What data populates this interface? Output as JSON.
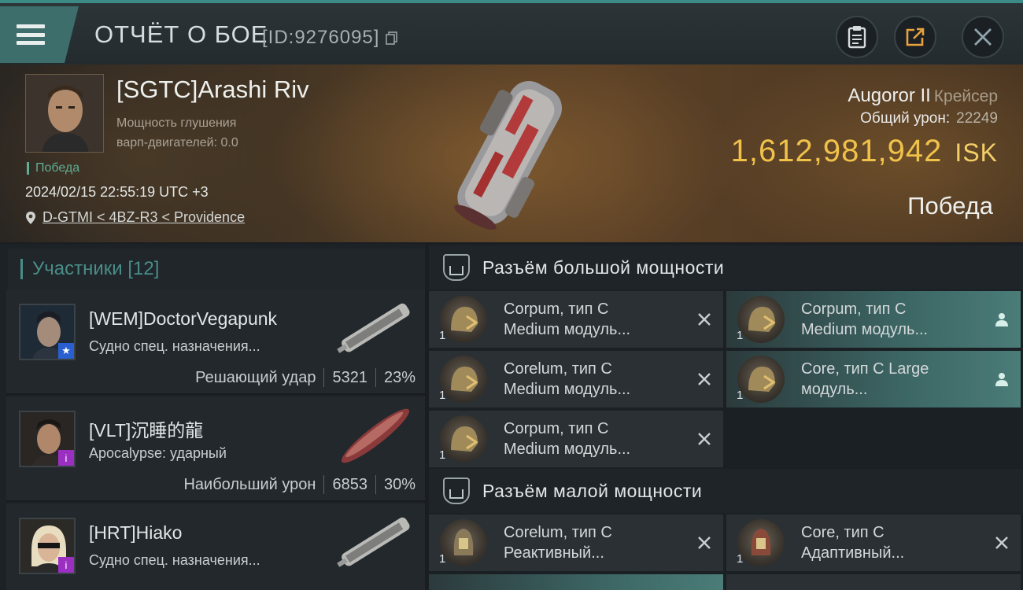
{
  "header": {
    "title": "ОТЧЁТ О БОЕ",
    "report_id": "[ID:9276095]",
    "buttons": {
      "clipboard_icon": "clipboard-icon",
      "share_icon": "share-icon",
      "close_icon": "close-icon"
    }
  },
  "victim": {
    "name": "[SGTC]Arashi Riv",
    "jam_label_line1": "Мощность глушения",
    "jam_label_line2": "варп-двигателей: 0.0",
    "status": "Победа",
    "datetime": "2024/02/15 22:55:19 UTC +3",
    "location": "D-GTMI < 4BZ-R3 < Providence",
    "ship": "Augoror II",
    "ship_class": "Крейсер",
    "total_damage_label": "Общий урон:",
    "total_damage": "22249",
    "isk_value": "1,612,981,942",
    "isk_unit": "ISK",
    "result": "Победа"
  },
  "participants": {
    "header": "Участники [12]",
    "items": [
      {
        "name": "[WEM]DoctorVegapunk",
        "ship": "Судно спец. назначения...",
        "role": "Решающий удар",
        "damage": "5321",
        "percent": "23%",
        "badge": "★",
        "badge_color": "#2a5fd0"
      },
      {
        "name": "[VLT]沉睡的龍",
        "ship": "Apocalypse: ударный",
        "role": "Наибольший урон",
        "damage": "6853",
        "percent": "30%",
        "badge": "i",
        "badge_color": "#9a2fc2"
      },
      {
        "name": "[HRT]Hiako",
        "ship": "Судно спец. назначения...",
        "role": "",
        "damage": "",
        "percent": "",
        "badge": "i",
        "badge_color": "#9a2fc2"
      }
    ]
  },
  "fittings": {
    "high_slot_title": "Разъём большой мощности",
    "high_slots": [
      {
        "name": "Corpum, тип C",
        "desc": "Medium модуль...",
        "qty": "1",
        "state": "destroyed"
      },
      {
        "name": "Corpum, тип C",
        "desc": "Medium модуль...",
        "qty": "1",
        "state": "dropped"
      },
      {
        "name": "Corelum, тип C",
        "desc": "Medium модуль...",
        "qty": "1",
        "state": "destroyed"
      },
      {
        "name": "Core, тип C Large",
        "desc": "модуль...",
        "qty": "1",
        "state": "dropped"
      },
      {
        "name": "Corpum, тип C",
        "desc": "Medium модуль...",
        "qty": "1",
        "state": "destroyed"
      }
    ],
    "low_slot_title": "Разъём малой мощности",
    "low_slots": [
      {
        "name": "Corelum, тип C",
        "desc": "Реактивный...",
        "qty": "1",
        "state": "destroyed"
      },
      {
        "name": "Core, тип C",
        "desc": "Адаптивный...",
        "qty": "1",
        "state": "destroyed"
      }
    ]
  },
  "colors": {
    "accent": "#3c8a86",
    "isk": "#f0c24a",
    "victory": "#5fae96"
  }
}
